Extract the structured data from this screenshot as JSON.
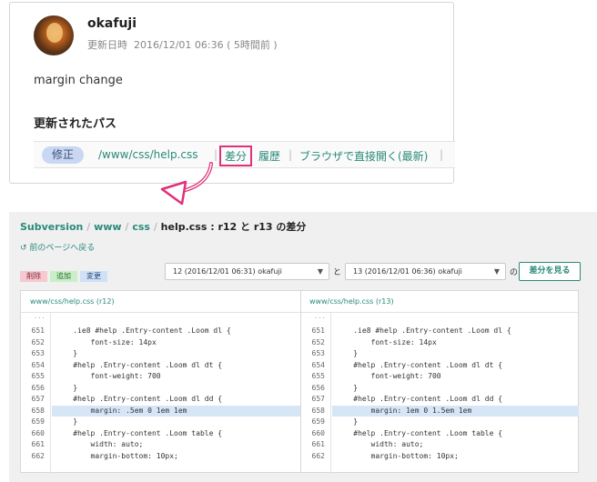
{
  "card": {
    "author": "okafuji",
    "updated_label": "更新日時",
    "updated_value": "2016/12/01 06:36 ( 5時間前 )",
    "message": "margin change",
    "paths_heading": "更新されたパス",
    "badge": "修正",
    "path": "/www/css/help.css",
    "diff_link": "差分",
    "history_link": "履歴",
    "browser_link": "ブラウザで直接開く(最新)"
  },
  "panel": {
    "breadcrumb": [
      "Subversion",
      "www",
      "css"
    ],
    "breadcrumb_current": "help.css : r12 と r13 の差分",
    "back": "前のページへ戻る",
    "legend": {
      "deleted": "削除",
      "added": "追加",
      "changed": "変更"
    },
    "select_left": "12 (2016/12/01 06:31) okafuji",
    "select_right": "13 (2016/12/01 06:36) okafuji",
    "conn_to": "と",
    "conn_of": "の",
    "show_diff": "差分を見る",
    "left_title": "www/css/help.css (r12)",
    "right_title": "www/css/help.css (r13)",
    "ellipsis": "...",
    "line_numbers": [
      "651",
      "652",
      "653",
      "654",
      "655",
      "656",
      "657",
      "658",
      "659",
      "660",
      "661",
      "662"
    ],
    "left_lines": [
      "    .ie8 #help .Entry-content .Loom dl {",
      "        font-size: 14px",
      "    }",
      "    #help .Entry-content .Loom dl dt {",
      "        font-weight: 700",
      "    }",
      "    #help .Entry-content .Loom dl dd {",
      "        margin: .5em 0 1em 1em",
      "    }",
      "    #help .Entry-content .Loom table {",
      "        width: auto;",
      "        margin-bottom: 10px;"
    ],
    "right_lines": [
      "    .ie8 #help .Entry-content .Loom dl {",
      "        font-size: 14px",
      "    }",
      "    #help .Entry-content .Loom dl dt {",
      "        font-weight: 700",
      "    }",
      "    #help .Entry-content .Loom dl dd {",
      "        margin: 1em 0 1.5em 1em",
      "    }",
      "    #help .Entry-content .Loom table {",
      "        width: auto;",
      "        margin-bottom: 10px;"
    ],
    "changed_line_index": 7
  },
  "colors": {
    "accent": "#2a8a7a",
    "highlight": "#e0307a",
    "changed": "#d7e6f7"
  }
}
